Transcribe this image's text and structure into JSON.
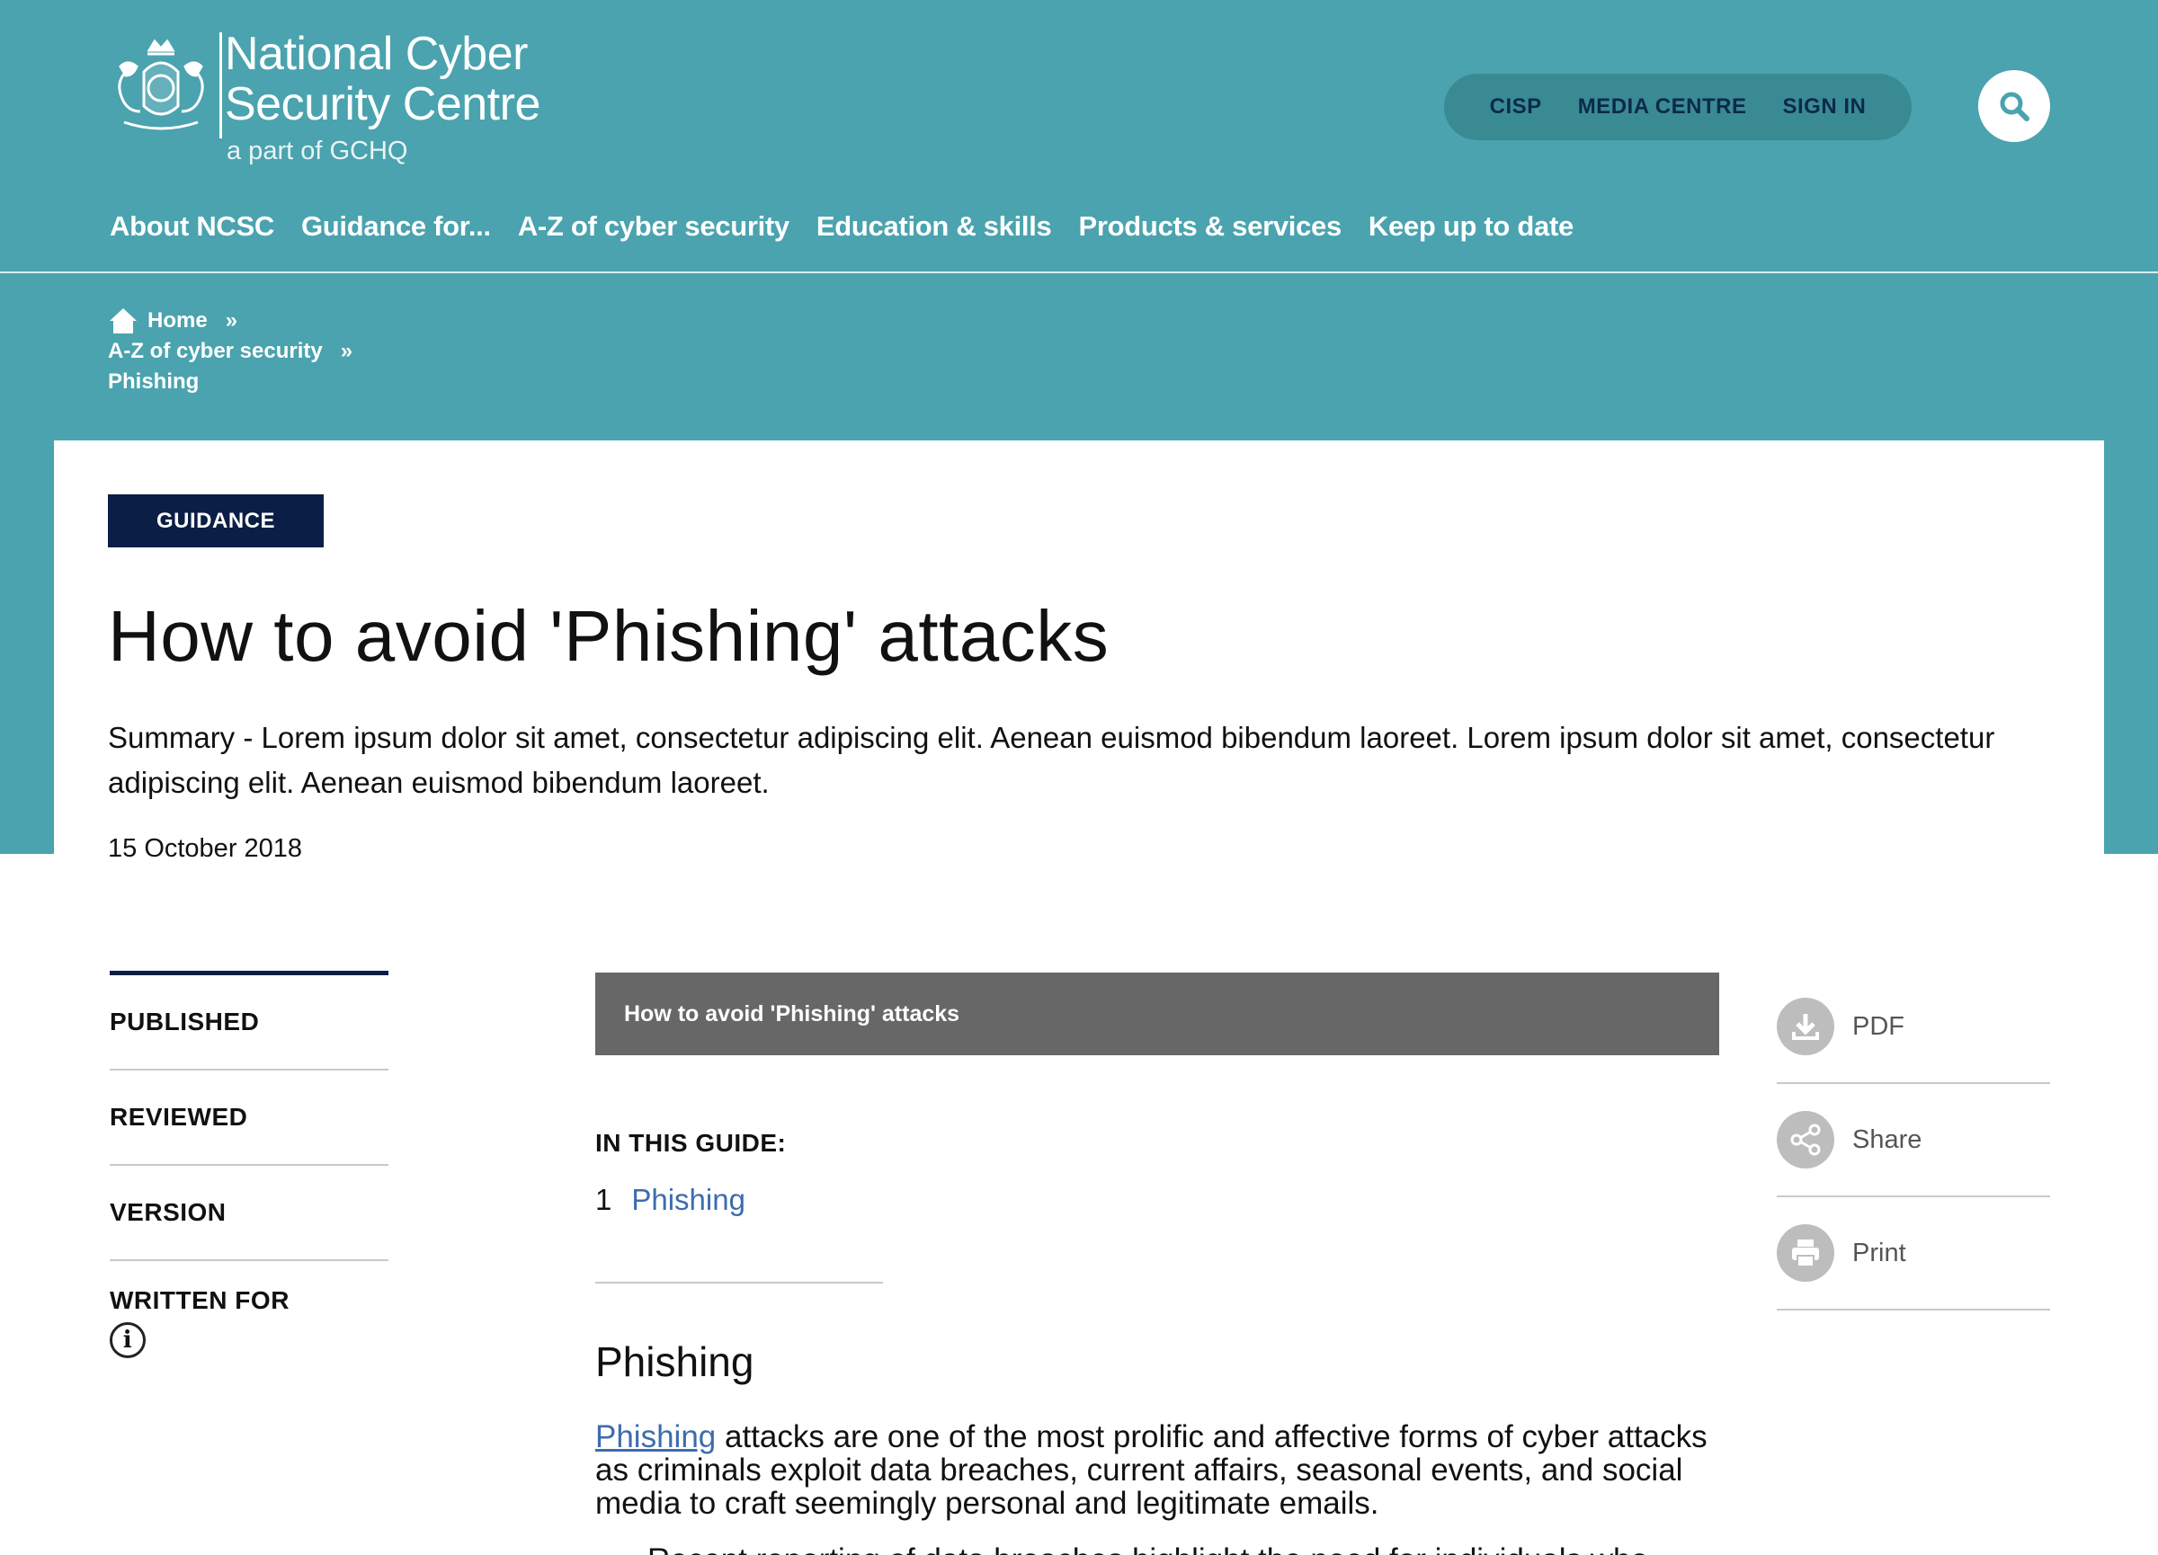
{
  "header": {
    "logo_title_line1": "National Cyber",
    "logo_title_line2": "Security Centre",
    "logo_sub": "a part of GCHQ",
    "util_nav": [
      "CISP",
      "MEDIA CENTRE",
      "SIGN IN"
    ],
    "main_nav": [
      "About NCSC",
      "Guidance for...",
      "A-Z of cyber security",
      "Education & skills",
      "Products & services",
      "Keep up to date"
    ]
  },
  "breadcrumb": {
    "home": "Home",
    "level2": "A-Z of cyber security",
    "current": "Phishing",
    "separator": "»"
  },
  "article": {
    "tag": "GUIDANCE",
    "title": "How to avoid 'Phishing' attacks",
    "summary": "Summary - Lorem ipsum dolor sit amet, consectetur adipiscing elit. Aenean euismod bibendum laoreet. Lorem ipsum dolor sit amet, consectetur adipiscing elit. Aenean euismod bibendum laoreet.",
    "date": "15 October 2018"
  },
  "meta": {
    "published": "PUBLISHED",
    "reviewed": "REVIEWED",
    "version": "VERSION",
    "written_for": "WRITTEN FOR",
    "info_glyph": "i"
  },
  "guide": {
    "bar_title": "How to avoid 'Phishing' attacks",
    "in_this_guide": "IN THIS GUIDE:",
    "items": [
      {
        "num": "1",
        "label": "Phishing"
      }
    ],
    "section_heading": "Phishing",
    "body_link": "Phishing",
    "body_text": " attacks are one of the most prolific and affective forms of cyber attacks as criminals exploit data breaches, current affairs, seasonal events, and social media to craft seemingly personal and legitimate emails.",
    "body_cut": "Recent reporting of data breaches highlight the need for individuals who"
  },
  "actions": [
    {
      "label": "PDF",
      "icon": "download-icon"
    },
    {
      "label": "Share",
      "icon": "share-icon"
    },
    {
      "label": "Print",
      "icon": "print-icon"
    }
  ],
  "colors": {
    "brand_teal": "#4aa3ae",
    "navy": "#0b1e45",
    "link_blue": "#3c6cae",
    "guide_bar": "#676767"
  }
}
